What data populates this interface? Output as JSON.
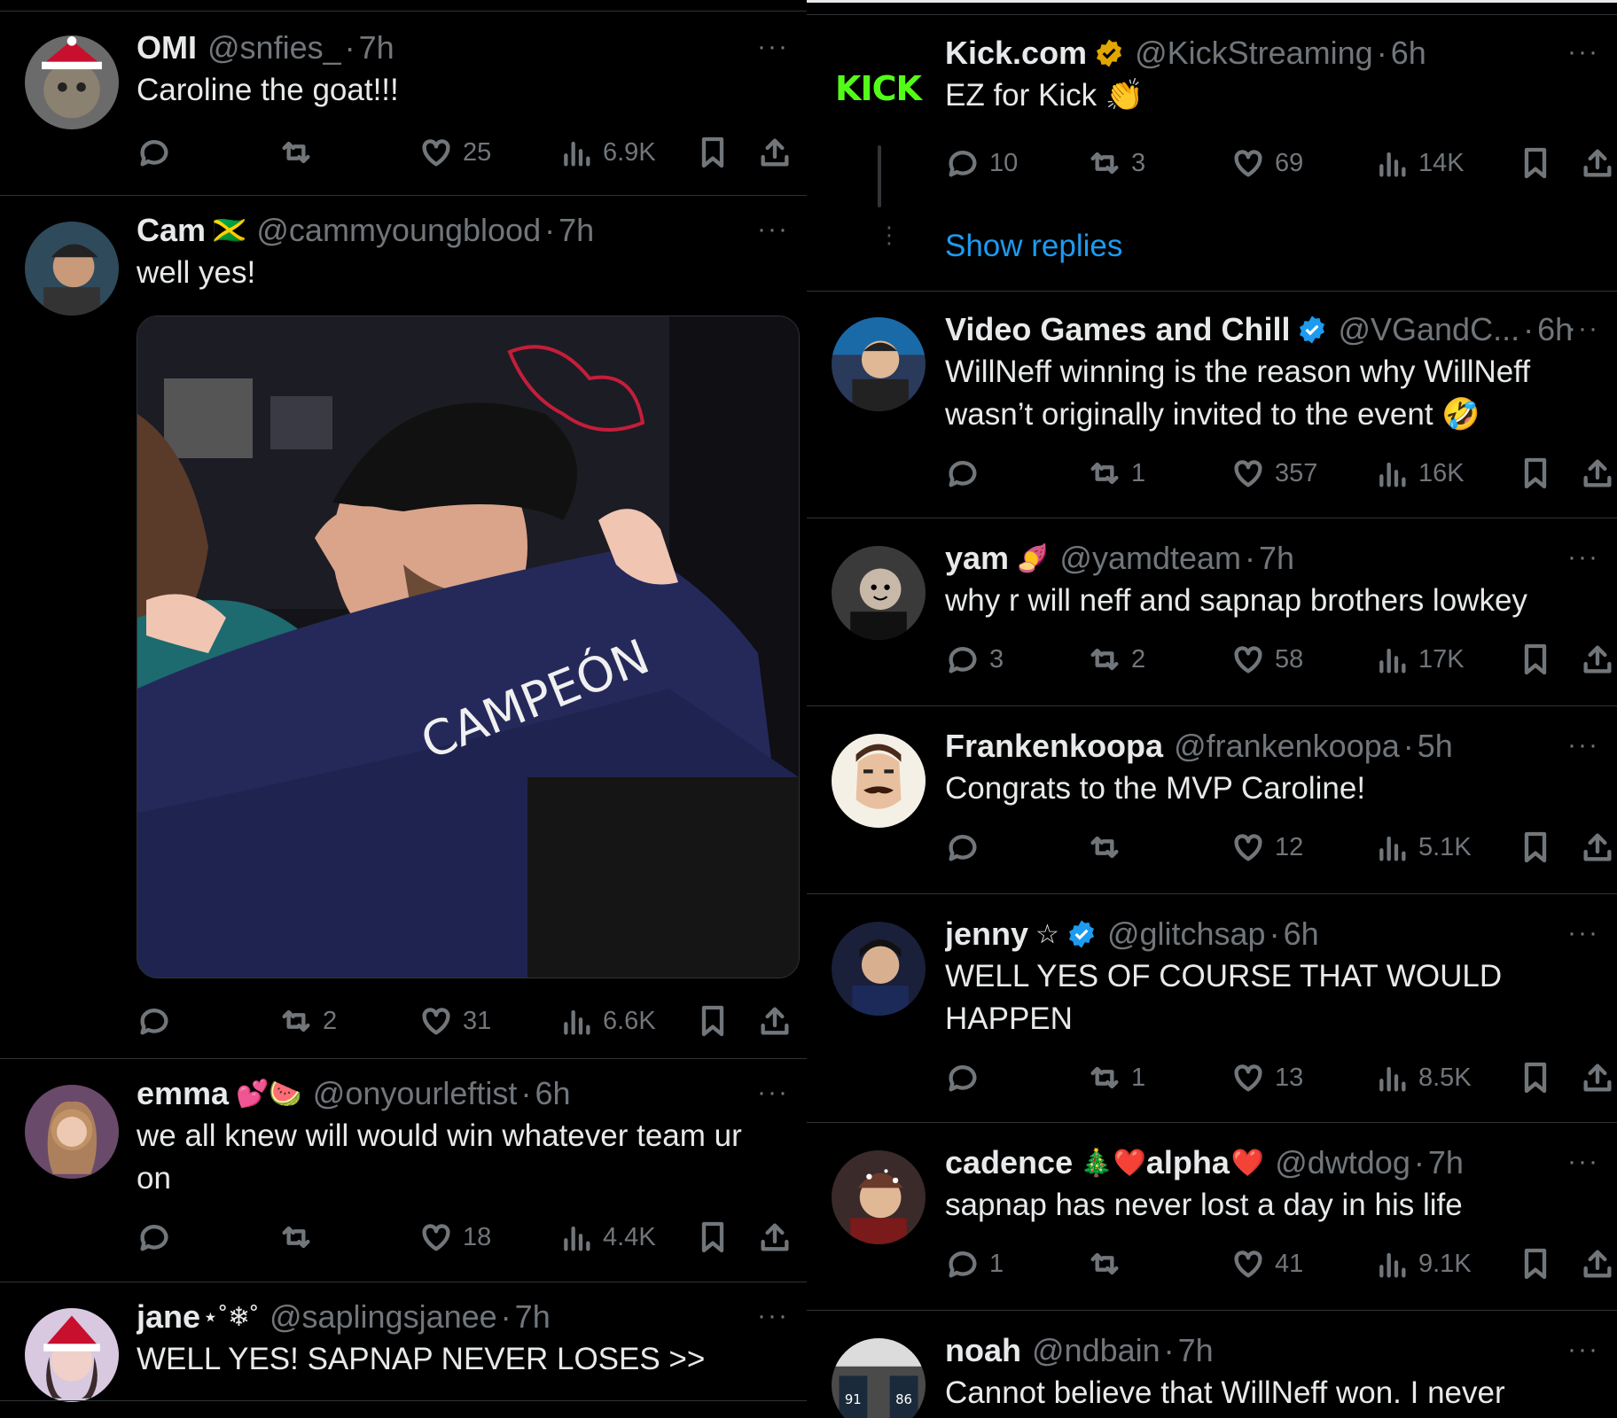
{
  "left_posts": [
    {
      "name": "OMI",
      "emoji": "",
      "handle": "@snfies_",
      "time": "7h",
      "text": "Caroline the goat!!!",
      "replies": "",
      "reposts": "",
      "likes": "25",
      "views": "6.9K"
    },
    {
      "name": "Cam",
      "emoji": "🇯🇲",
      "handle": "@cammyoungblood",
      "time": "7h",
      "text": "well yes!",
      "replies": "",
      "reposts": "2",
      "likes": "31",
      "views": "6.6K",
      "image_text": "CAMPEÓN"
    },
    {
      "name": "emma",
      "emoji": "💕🍉",
      "handle": "@onyourleftist",
      "time": "6h",
      "text": "we all knew will would win whatever team ur on",
      "replies": "",
      "reposts": "",
      "likes": "18",
      "views": "4.4K"
    },
    {
      "name": "jane",
      "emoji": "⋆˚❄︎˚",
      "handle": "@saplingsjanee",
      "time": "7h",
      "text": "WELL YES! SAPNAP NEVER LOSES >>"
    }
  ],
  "right_posts": [
    {
      "name": "Kick.com",
      "verified": true,
      "verified_color": "#e2a600",
      "handle": "@KickStreaming",
      "time": "6h",
      "text": "EZ for Kick 👏",
      "replies": "10",
      "reposts": "3",
      "likes": "69",
      "views": "14K",
      "avatar_text": "KICK",
      "show_replies": "Show replies"
    },
    {
      "name": "Video Games and Chill",
      "verified": true,
      "verified_color": "#1d9bf0",
      "handle": "@VGandC...",
      "time": "6h",
      "text": "WillNeff winning is the reason why WillNeff wasn’t originally invited to the event 🤣",
      "replies": "",
      "reposts": "1",
      "likes": "357",
      "views": "16K"
    },
    {
      "name": "yam",
      "emoji": "🍠",
      "handle": "@yamdteam",
      "time": "7h",
      "text": "why r will neff and sapnap brothers lowkey",
      "replies": "3",
      "reposts": "2",
      "likes": "58",
      "views": "17K"
    },
    {
      "name": "Frankenkoopa",
      "handle": "@frankenkoopa",
      "time": "5h",
      "text": "Congrats to the MVP Caroline!",
      "replies": "",
      "reposts": "",
      "likes": "12",
      "views": "5.1K"
    },
    {
      "name": "jenny",
      "emoji": "☆",
      "verified": true,
      "verified_color": "#1d9bf0",
      "handle": "@glitchsap",
      "time": "6h",
      "text": "WELL YES OF COURSE THAT WOULD HAPPEN",
      "replies": "",
      "reposts": "1",
      "likes": "13",
      "views": "8.5K"
    },
    {
      "name": "cadence",
      "emoji": "🎄❤️",
      "name2": "alpha",
      "emoji2": "❤️",
      "handle": "@dwtdog",
      "time": "7h",
      "text": "sapnap has never lost a day in his life",
      "replies": "1",
      "reposts": "",
      "likes": "41",
      "views": "9.1K"
    },
    {
      "name": "noah",
      "handle": "@ndbain",
      "time": "7h",
      "text": "Cannot believe that WillNeff won. I never"
    }
  ],
  "icons": {
    "reply": "reply-icon",
    "repost": "repost-icon",
    "like": "heart-icon",
    "views": "views-icon",
    "bookmark": "bookmark-icon",
    "share": "share-icon",
    "more": "more-icon",
    "verified": "verified-badge-icon"
  },
  "more_glyph": "···",
  "dot": "·"
}
